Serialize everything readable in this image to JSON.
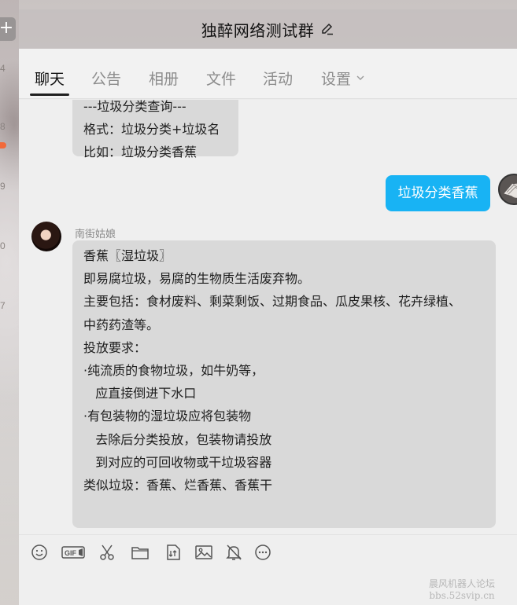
{
  "window": {
    "title": "独醉网络测试群",
    "left_strip_numbers": [
      "4",
      "8",
      "9",
      "0",
      "7"
    ]
  },
  "tabs": [
    {
      "label": "聊天",
      "active": true
    },
    {
      "label": "公告",
      "active": false
    },
    {
      "label": "相册",
      "active": false
    },
    {
      "label": "文件",
      "active": false
    },
    {
      "label": "活动",
      "active": false
    },
    {
      "label": "设置",
      "active": false
    }
  ],
  "messages": {
    "top_bubble": {
      "lines": [
        "---垃圾分类查询---",
        "格式：垃圾分类+垃圾名",
        "比如：垃圾分类香蕉"
      ]
    },
    "my_message": {
      "text": "垃圾分类香蕉"
    },
    "reply": {
      "sender": "南街姑娘",
      "lines": [
        "香蕉〖湿垃圾〗",
        "即易腐垃圾，易腐的生物质生活废弃物。",
        "主要包括：食材废料、剩菜剩饭、过期食品、瓜皮果核、花卉绿植、",
        "中药药渣等。",
        "投放要求：",
        "·纯流质的食物垃圾，如牛奶等，",
        "   应直接倒进下水口",
        "·有包装物的湿垃圾应将包装物",
        "   去除后分类投放，包装物请投放",
        "   到对应的可回收物或干垃圾容器",
        "",
        "类似垃圾：香蕉、烂香蕉、香蕉干"
      ]
    }
  },
  "toolbar": {
    "icons": [
      "emoji-icon",
      "gif-icon",
      "scissors-icon",
      "folder-icon",
      "file-transfer-icon",
      "image-icon",
      "bell-mute-icon",
      "more-icon"
    ]
  },
  "watermark": {
    "line1": "晨风机器人论坛",
    "line2": "bbs.52svip.cn"
  },
  "colors": {
    "my_bubble": "#18b3f4",
    "other_bubble": "#d9d9d9",
    "unread_dot": "#f26a3a"
  }
}
